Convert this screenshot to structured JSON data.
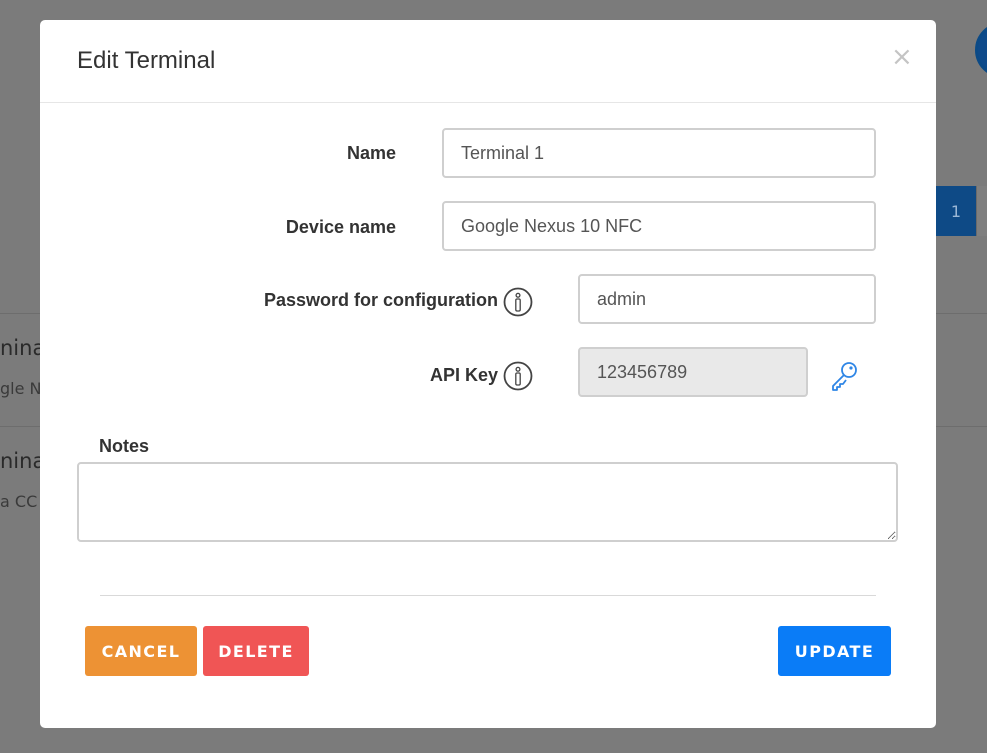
{
  "modal": {
    "title": "Edit Terminal",
    "close_symbol": "×",
    "fields": {
      "name": {
        "label": "Name",
        "value": "Terminal 1"
      },
      "device_name": {
        "label": "Device name",
        "value": "Google Nexus 10 NFC"
      },
      "password": {
        "label": "Password for configuration",
        "value": "admin",
        "icon": "info-icon"
      },
      "api_key": {
        "label": "API Key",
        "value": "123456789",
        "icon": "info-icon",
        "action_icon": "key-icon"
      },
      "notes": {
        "label": "Notes",
        "value": ""
      }
    },
    "buttons": {
      "cancel": {
        "label": "CANCEL",
        "color": "#ed9234"
      },
      "delete": {
        "label": "DELETE",
        "color": "#f05555"
      },
      "update": {
        "label": "UPDATE",
        "color": "#0a7cf7"
      }
    }
  },
  "background": {
    "pagination_current": "1",
    "row1_title": "nina",
    "row1_sub": "gle N",
    "row2_title": "nina",
    "row2_sub": "a CC"
  }
}
